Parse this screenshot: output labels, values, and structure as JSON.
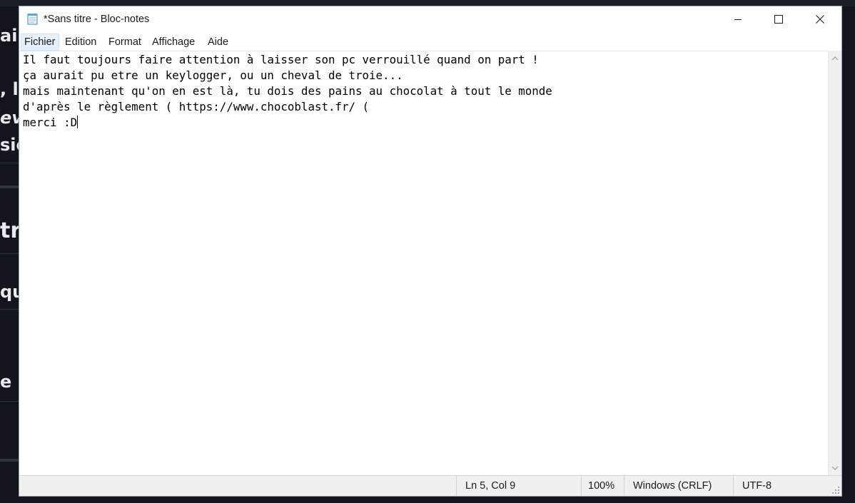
{
  "window": {
    "title": "*Sans titre - Bloc-notes"
  },
  "menu": {
    "items": [
      "Fichier",
      "Edition",
      "Format",
      "Affichage",
      "Aide"
    ],
    "active_index": 0
  },
  "editor": {
    "lines": [
      "Il faut toujours faire attention à laisser son pc verrouillé quand on part !",
      "ça aurait pu etre un keylogger, ou un cheval de troie...",
      "mais maintenant qu'on en est là, tu dois des pains au chocolat à tout le monde",
      "d'après le règlement ( https://www.chocoblast.fr/ (",
      "merci :D"
    ]
  },
  "status": {
    "position": "Ln 5, Col 9",
    "zoom": "100%",
    "line_ending": "Windows (CRLF)",
    "encoding": "UTF-8"
  },
  "icons": {
    "app": "notepad-icon",
    "minimize": "minimize-icon",
    "maximize": "maximize-icon",
    "close": "close-icon",
    "scroll_up": "chevron-up-icon",
    "scroll_down": "chevron-down-icon",
    "resize": "resize-grip-icon"
  },
  "colors": {
    "menu_highlight": "#e5f1fb",
    "statusbar": "#f0f0f0",
    "background_page": "#12161c"
  }
}
